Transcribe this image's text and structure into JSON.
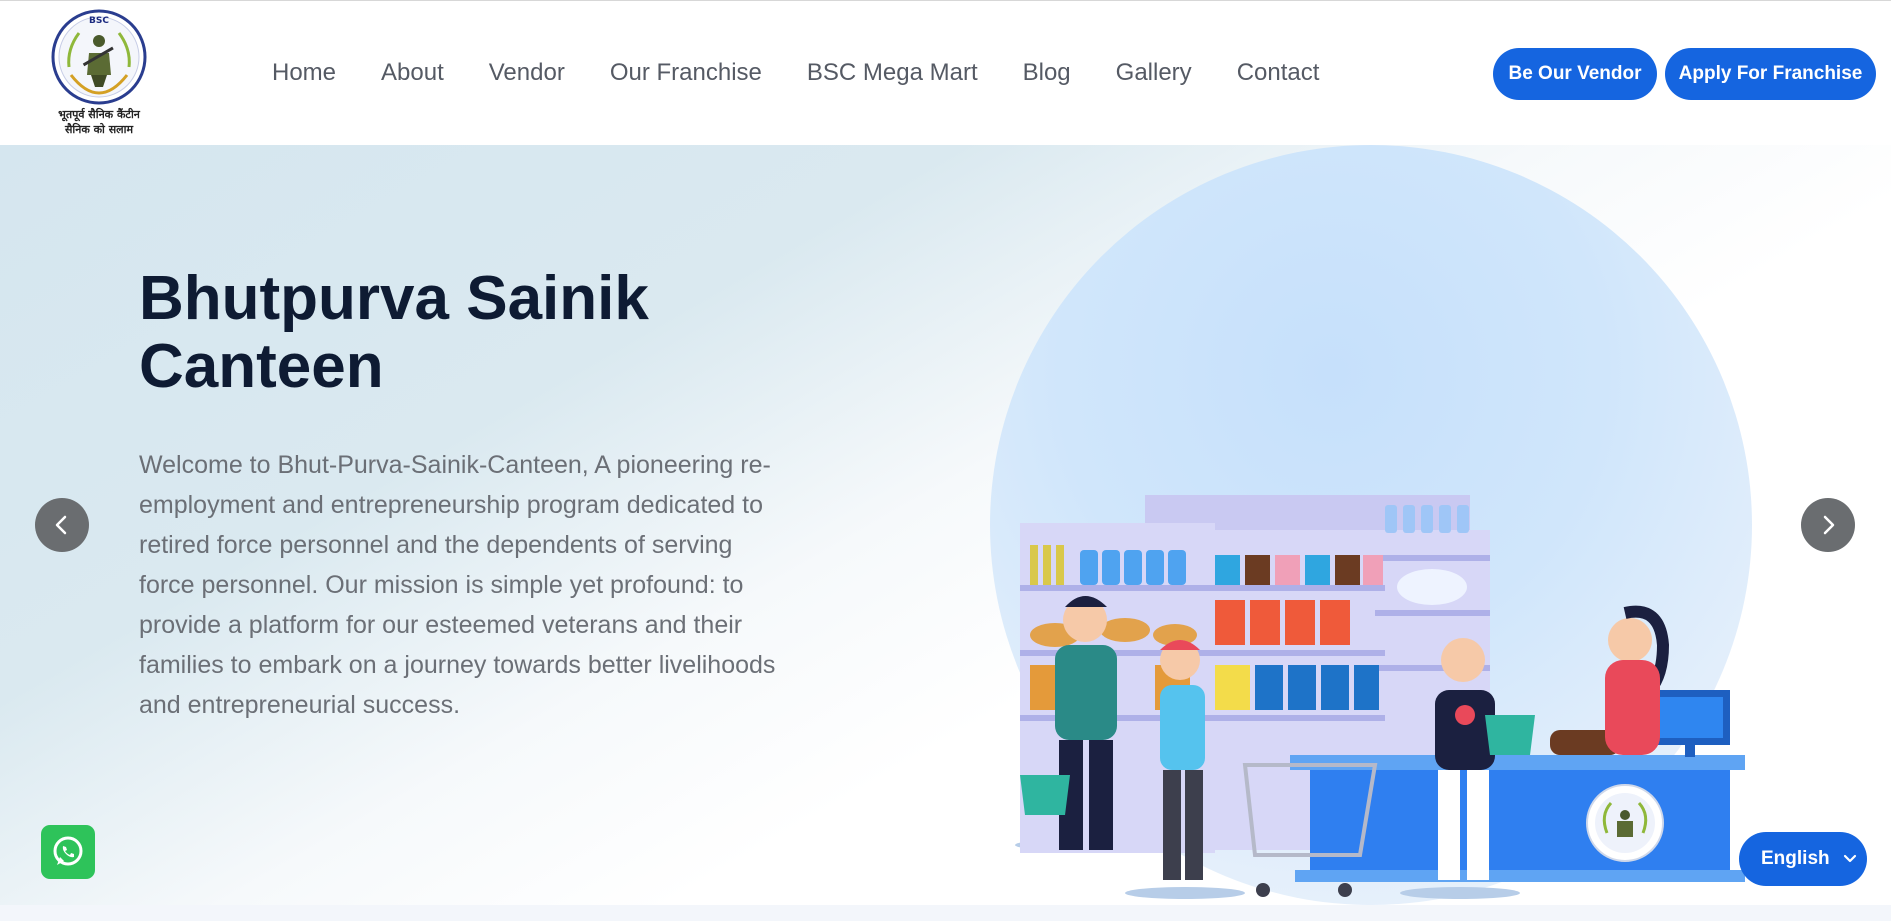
{
  "brand": {
    "badge_text": "BSC",
    "tagline_line1": "भूतपूर्व सैनिक कैंटीन",
    "tagline_line2": "सैनिक को सलाम"
  },
  "nav": {
    "items": [
      {
        "label": "Home"
      },
      {
        "label": "About"
      },
      {
        "label": "Vendor"
      },
      {
        "label": "Our Franchise"
      },
      {
        "label": "BSC Mega Mart"
      },
      {
        "label": "Blog"
      },
      {
        "label": "Gallery"
      },
      {
        "label": "Contact"
      }
    ]
  },
  "header_buttons": {
    "vendor_label": "Be Our Vendor",
    "franchise_label": "Apply For Franchise"
  },
  "hero": {
    "title": "Bhutpurva Sainik Canteen",
    "description": "Welcome to Bhut-Purva-Sainik-Canteen, A pioneering re-employment and entrepreneurship program dedicated to retired force personnel and the dependents of serving force personnel. Our mission is simple yet profound: to provide a platform for our esteemed veterans and their families to embark on a journey towards better livelihoods and entrepreneurial success.",
    "prev_icon": "chevron-left-icon",
    "next_icon": "chevron-right-icon"
  },
  "language_selector": {
    "selected": "English"
  },
  "floating": {
    "whatsapp_icon": "whatsapp-icon"
  },
  "colors": {
    "primary": "#1565e0",
    "heading": "#0e1b33",
    "body_text": "#6b6f76",
    "whatsapp": "#2ec35a"
  }
}
